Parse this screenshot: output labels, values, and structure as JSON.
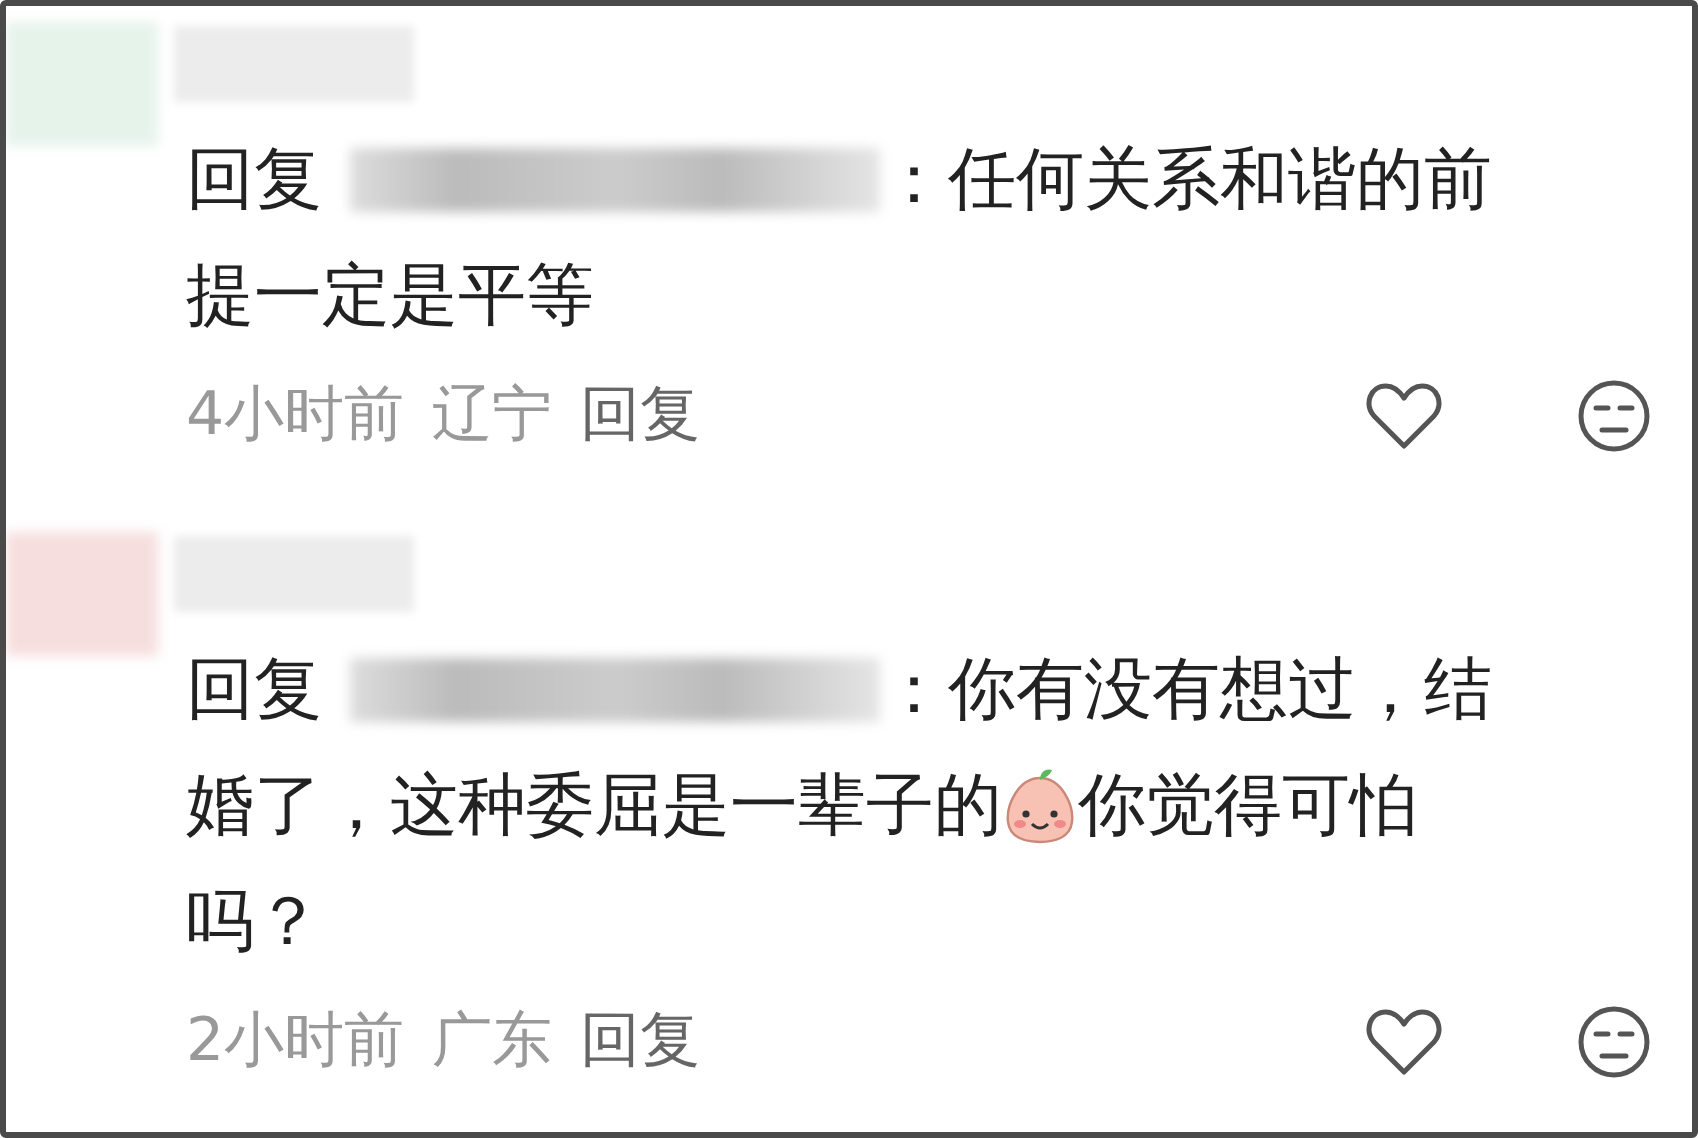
{
  "comments": [
    {
      "reply_label": "回复",
      "lines": [
        [
          {
            "kind": "text",
            "text": "：任何关系和谐的前"
          }
        ],
        [
          {
            "kind": "text",
            "text": "提一定是平等"
          }
        ]
      ],
      "time": "4小时前",
      "location": "辽宁",
      "reply_action": "回复"
    },
    {
      "reply_label": "回复",
      "lines": [
        [
          {
            "kind": "text",
            "text": "：你有没有想过，结"
          }
        ],
        [
          {
            "kind": "text",
            "text": "婚了，这种委屈是一辈子的"
          },
          {
            "kind": "emoji"
          },
          {
            "kind": "text",
            "text": "你觉得可怕"
          }
        ],
        [
          {
            "kind": "text",
            "text": "吗？"
          }
        ]
      ],
      "time": "2小时前",
      "location": "广东",
      "reply_action": "回复"
    }
  ]
}
